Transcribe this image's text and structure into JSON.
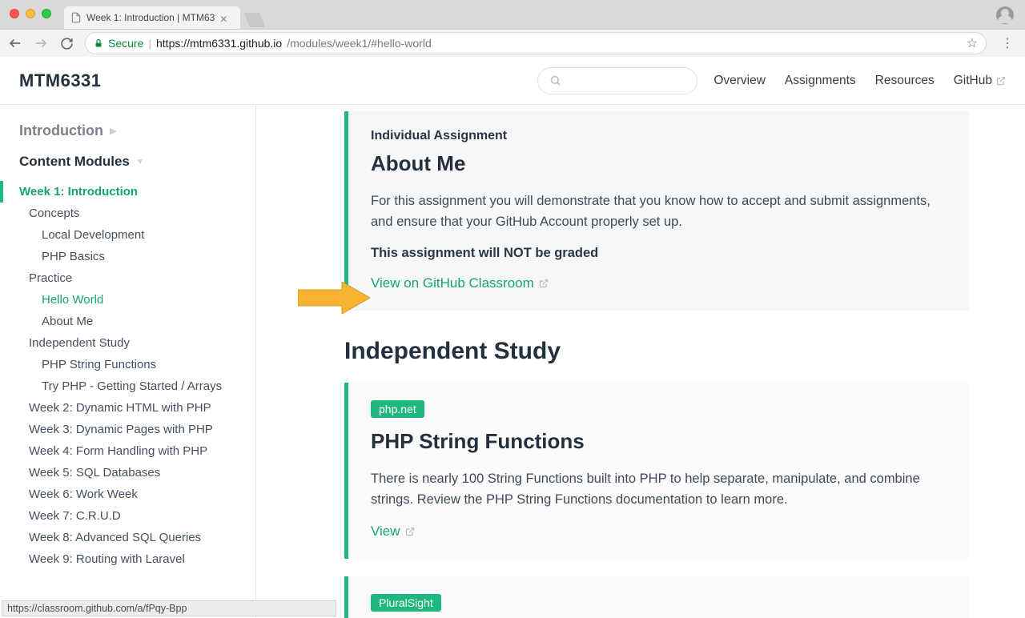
{
  "browser": {
    "tab_title": "Week 1: Introduction | MTM63",
    "url_secure_label": "Secure",
    "url_host": "https://mtm6331.github.io",
    "url_path": "/modules/week1/#hello-world",
    "status_bar": "https://classroom.github.com/a/fPqy-Bpp"
  },
  "header": {
    "title": "MTM6331",
    "nav": [
      "Overview",
      "Assignments",
      "Resources",
      "GitHub"
    ]
  },
  "sidebar": {
    "breadcrumb": "Introduction",
    "section": "Content Modules",
    "active": "Week 1: Introduction",
    "groups": [
      {
        "label": "Concepts",
        "items": [
          "Local Development",
          "PHP Basics"
        ]
      },
      {
        "label": "Practice",
        "items": [
          "Hello World",
          "About Me"
        ],
        "active_item": "Hello World"
      },
      {
        "label": "Independent Study",
        "items": [
          "PHP String Functions",
          "Try PHP - Getting Started / Arrays"
        ]
      }
    ],
    "weeks": [
      "Week 2: Dynamic HTML with PHP",
      "Week 3: Dynamic Pages with PHP",
      "Week 4: Form Handling with PHP",
      "Week 5: SQL Databases",
      "Week 6: Work Week",
      "Week 7: C.R.U.D",
      "Week 8: Advanced SQL Queries",
      "Week 9: Routing with Laravel"
    ]
  },
  "content": {
    "assignment_card": {
      "meta": "Individual Assignment",
      "title": "About Me",
      "body": "For this assignment you will demonstrate that you know how to accept and submit assignments, and ensure that your GitHub Account properly set up.",
      "emph": "This assignment will NOT be graded",
      "link": "View on GitHub Classroom"
    },
    "section_heading": "Independent Study",
    "study_card1": {
      "badge": "php.net",
      "title": "PHP String Functions",
      "body": "There is nearly 100 String Functions built into PHP to help separate, manipulate, and combine strings. Review the PHP String Functions documentation to learn more.",
      "link": "View"
    },
    "study_card2": {
      "badge": "PluralSight"
    }
  }
}
